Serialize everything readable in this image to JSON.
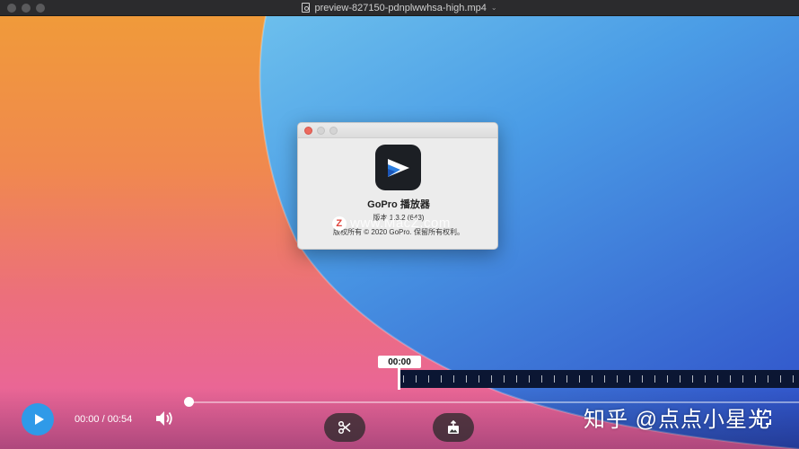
{
  "window": {
    "title": "preview-827150-pdnplwwhsa-high.mp4"
  },
  "about_dialog": {
    "app_name": "GoPro 播放器",
    "version": "版本 1.3.2 (643)",
    "copyright": "版权所有 © 2020 GoPro. 保留所有权利。",
    "watermark": "www.MacZ.com",
    "watermark_badge": "Z"
  },
  "player": {
    "timeline_tip": "00:00",
    "time_display": "00:00 / 00:54",
    "progress_fraction": 0.0,
    "overlay_text": "知乎 @点点小星光",
    "accent_color": "#2f9ae8"
  }
}
